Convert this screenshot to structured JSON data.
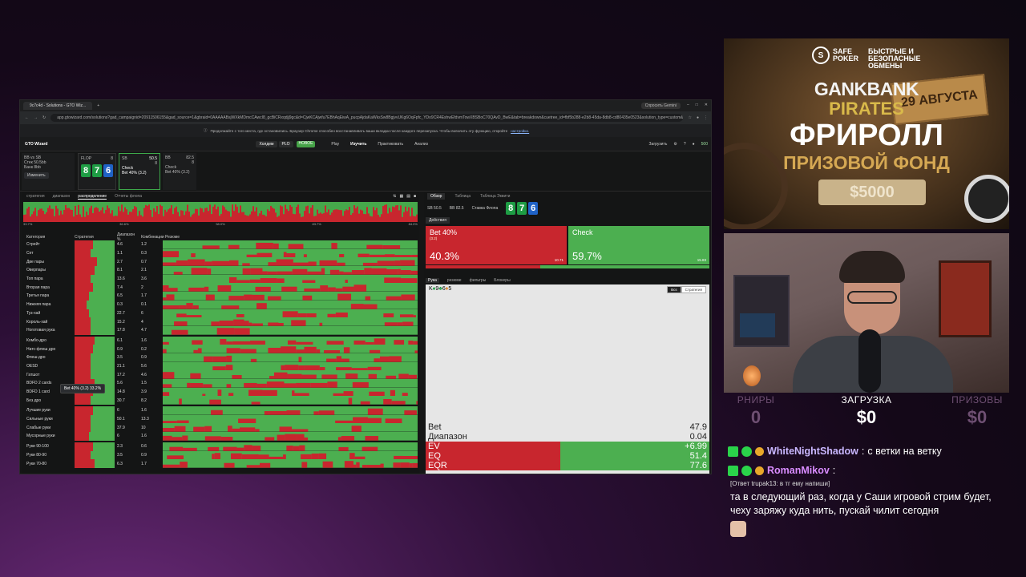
{
  "browser": {
    "tabs": [
      "9c7c4d - Solutions - GTO Wiz..."
    ],
    "ask_ai": "Спросить Gemini",
    "url": "app.gtowizard.com/solutions?gad_campaignid=20911506155&gad_source=1&gbraid=0AAAAABsjWXkMDmcCAwcI8_gcBiCRxqdjj9gc&d=CjwKCAjwfu7EBhAqEiwA_pucpAjdaKaWksSw8BgjvvUKg6OqFpfc_YDo9CR4EshwEfdvmTowXBSBoC70QAvD_BwE&tab=breakdown&cuetree_id=fbf5b288-e2b8-45da-8db8-cd80435e0523&solution_type=custom&gfeeds_solut...",
    "infobar_text": "Продолжайте с того места, где остановились. Браузер Chrome способен восстанавливать ваши вкладки после каждого перезапуска. Чтобы включить эту функцию, откройте",
    "infobar_link": "настройки."
  },
  "app": {
    "logo": "GTO Wizard",
    "modes": [
      "Холдем",
      "PLO"
    ],
    "mode_tag": "НОВОЕ",
    "nav": [
      "Play",
      "Изучить",
      "Практиковать",
      "Анализ"
    ],
    "upload": "Загрузить",
    "points": "500"
  },
  "spot": {
    "scenario": "BB vs SB",
    "stack": "Стек 50.5bb",
    "bank": "Банк 8bb",
    "edit_btn": "Изменить",
    "flop_label": "FLOP",
    "flop_pot": "8",
    "board": [
      "8",
      "7",
      "6"
    ],
    "sb_card": {
      "pos": "SB",
      "val": "50.5",
      "pot": "8",
      "line1": "Check",
      "line2": "Bet 40%",
      "size": "(3.2)"
    },
    "bb_card": {
      "pos": "BB",
      "val": "82.5",
      "pot": "8",
      "line1": "Check",
      "line2": "Bet 40%",
      "size": "(3.2)"
    }
  },
  "left": {
    "tabs": [
      "стратегия",
      "диапазон",
      "распределение",
      "Отчеты флопа"
    ],
    "active_tab": "распределение",
    "axis": [
      "33.7%",
      "36.6%",
      "58.0%",
      "83.7%",
      "84.0%"
    ],
    "columns": [
      "Категория",
      "Стратегия",
      "Диапазон %",
      "Комбинации",
      "Резюме"
    ],
    "tooltip": "Bet 40% (3.2) 33.2%",
    "rows": [
      {
        "name": "Стрейт",
        "range": "4.6",
        "combos": "1.2",
        "bet": 0.45
      },
      {
        "name": "Сет",
        "range": "1.1",
        "combos": "0.3",
        "bet": 0.4
      },
      {
        "name": "Две пары",
        "range": "2.7",
        "combos": "0.7",
        "bet": 0.55
      },
      {
        "name": "Оверпары",
        "range": "8.1",
        "combos": "2.1",
        "bet": 0.5
      },
      {
        "name": "Топ пара",
        "range": "13.6",
        "combos": "3.6",
        "bet": 0.4
      },
      {
        "name": "Вторая пара",
        "range": "7.4",
        "combos": "2",
        "bet": 0.45
      },
      {
        "name": "Третья пара",
        "range": "6.5",
        "combos": "1.7",
        "bet": 0.35
      },
      {
        "name": "Нижняя пара",
        "range": "0.3",
        "combos": "0.1",
        "bet": 0.3
      },
      {
        "name": "Туз-хай",
        "range": "22.7",
        "combos": "6",
        "bet": 0.35
      },
      {
        "name": "Король-хай",
        "range": "15.2",
        "combos": "4",
        "bet": 0.4
      },
      {
        "name": "Ноготовая рука",
        "range": "17.8",
        "combos": "4.7",
        "bet": 0.4
      },
      {
        "name": "Комбо-дро",
        "range": "6.1",
        "combos": "1.6",
        "bet": 0.5
      },
      {
        "name": "Натс-флеш дро",
        "range": "0.9",
        "combos": "0.2",
        "bet": 0.45
      },
      {
        "name": "Флеш-дро",
        "range": "3.5",
        "combos": "0.9",
        "bet": 0.4
      },
      {
        "name": "OESD",
        "range": "21.1",
        "combos": "5.6",
        "bet": 0.4
      },
      {
        "name": "Гатшот",
        "range": "17.2",
        "combos": "4.6",
        "bet": 0.4
      },
      {
        "name": "BDFD 2 cards",
        "range": "5.6",
        "combos": "1.5",
        "bet": 0.5
      },
      {
        "name": "BDFD 1 card",
        "range": "14.8",
        "combos": "3.9",
        "bet": 0.45
      },
      {
        "name": "Без дро",
        "range": "30.7",
        "combos": "8.2",
        "bet": 0.4
      },
      {
        "name": "Лучшие руки",
        "range": "6",
        "combos": "1.6",
        "bet": 0.45
      },
      {
        "name": "Сильные руки",
        "range": "50.1",
        "combos": "13.3",
        "bet": 0.4
      },
      {
        "name": "Слабые руки",
        "range": "37.9",
        "combos": "10",
        "bet": 0.4
      },
      {
        "name": "Мусорные руки",
        "range": "6",
        "combos": "1.6",
        "bet": 0.35
      },
      {
        "name": "Руки 90-100",
        "range": "2.3",
        "combos": "0.6",
        "bet": 0.45
      },
      {
        "name": "Руки 80-90",
        "range": "3.5",
        "combos": "0.9",
        "bet": 0.4
      },
      {
        "name": "Руки 70-80",
        "range": "6.3",
        "combos": "1.7",
        "bet": 0.5
      }
    ]
  },
  "right": {
    "tabs": [
      "Обзор",
      "Таблица",
      "Таблица Эквити"
    ],
    "spots": [
      "SB 50.5",
      "BB 82.5",
      "Ставка Флопа"
    ],
    "board": [
      "8",
      "7",
      "6"
    ],
    "actions_label": "Действия",
    "bet": {
      "name": "Bet 40%",
      "size": "(3.2)",
      "pct": "40.3%",
      "combos": "10.71",
      "pct_value": 0.403
    },
    "check": {
      "name": "Check",
      "pct": "59.7%",
      "combos": "15.83"
    },
    "hand_tabs": [
      "Рука",
      "резюме",
      "фильтры",
      "Блокеры"
    ],
    "hand": [
      "K",
      "♠",
      "9",
      "♣",
      "6",
      "♦",
      "5"
    ],
    "toggle": [
      "Bcs",
      "Стратегия"
    ],
    "stats": [
      {
        "k": "Bet",
        "v": "47.9"
      },
      {
        "k": "Диапазон",
        "v": "0.04"
      }
    ],
    "evs": [
      {
        "k": "EV",
        "v": "+6.99"
      },
      {
        "k": "EQ",
        "v": "51.4"
      },
      {
        "k": "EQR",
        "v": "77.6"
      }
    ]
  },
  "ad": {
    "brand": "SAFE POKER",
    "slogan": "БЫСТРЫЕ И БЕЗОПАСНЫЕ ОБМЕНЫ",
    "title1": "GANKBANK",
    "title2": "PIRATES",
    "date": "29 АВГУСТА",
    "freeroll": "ФРИРОЛЛ",
    "prize": "ПРИЗОВОЙ ФОНД",
    "amount": "$5000"
  },
  "widget": {
    "left": {
      "label": "РНИРЫ",
      "value": "0"
    },
    "center": {
      "label": "ЗАГРУЗКА",
      "value": "$0"
    },
    "right": {
      "label": "ПРИЗОВЫ",
      "value": "$0"
    }
  },
  "chat": {
    "msg1": {
      "user": "WhiteNightShadow",
      "text": "с ветки на ветку"
    },
    "msg2": {
      "user": "RomanMikov",
      "reply": "[Ответ trupak13: в тг ему напиши]",
      "text": "та в следующий раз, когда у Саши игровой стрим будет, чеху заряжу куда нить, пускай чилит сегодня"
    }
  }
}
